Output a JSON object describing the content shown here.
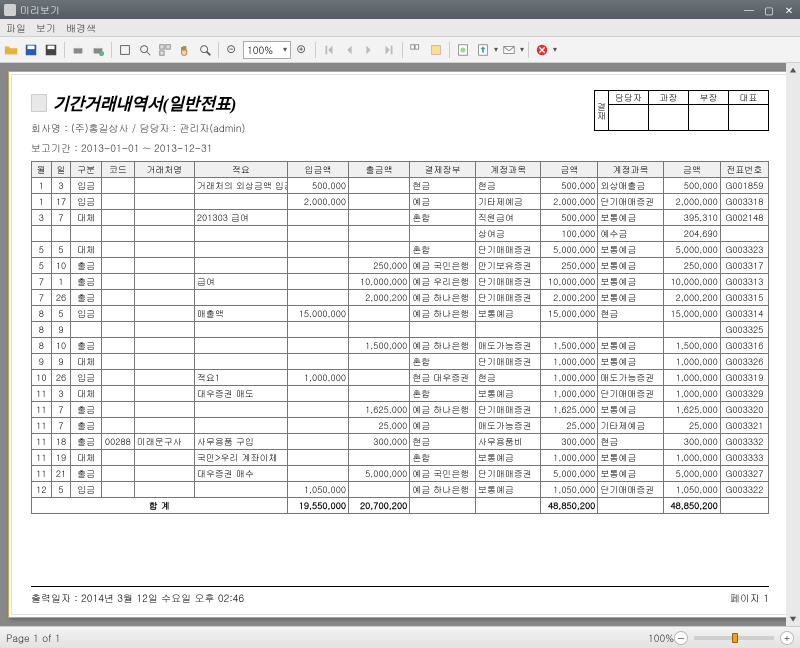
{
  "window": {
    "title": "미리보기"
  },
  "menu": {
    "file": "파일",
    "view": "보기",
    "bg": "배경색"
  },
  "toolbar": {
    "zoom": "100%"
  },
  "report": {
    "title": "기간거래내역서(일반전표)",
    "company_line": "회사명 :  (주)홍길상사 / 담당자 : 관리자(admin)",
    "period_line": "보고기간 :  2013-01-01  ~ 2013-12-31",
    "print_date": "출력일자 : 2014년 3월 12일 수요일 오후 02:46",
    "page_label": "페이지 1"
  },
  "approval": {
    "side": "결재",
    "c1": "담당자",
    "c2": "과장",
    "c3": "부장",
    "c4": "대표"
  },
  "columns": [
    "월",
    "일",
    "구분",
    "코드",
    "거래처명",
    "적요",
    "입금액",
    "출금액",
    "결제장부",
    "계정과목",
    "금액",
    "계정과목",
    "금액",
    "전표번호"
  ],
  "rows": [
    {
      "m": "1",
      "d": "3",
      "t": "입금",
      "code": "",
      "cust": "",
      "memo": "거래처의 외상금액 입금",
      "in": "500,000",
      "out": "",
      "book": "현금",
      "acc1": "현금",
      "amt1": "500,000",
      "acc2": "외상매출금",
      "amt2": "500,000",
      "no": "G001859"
    },
    {
      "m": "1",
      "d": "17",
      "t": "입금",
      "code": "",
      "cust": "",
      "memo": "",
      "in": "2,000,000",
      "out": "",
      "book": "예금",
      "acc1": "기타제예금",
      "amt1": "2,000,000",
      "acc2": "단기매매증권",
      "amt2": "2,000,000",
      "no": "G003318"
    },
    {
      "m": "3",
      "d": "7",
      "t": "대체",
      "code": "",
      "cust": "",
      "memo": "201303 급여",
      "in": "",
      "out": "",
      "book": "혼합",
      "acc1": "직원급여",
      "amt1": "500,000",
      "acc2": "보통예금",
      "amt2": "395,310",
      "no": "G002148"
    },
    {
      "m": "",
      "d": "",
      "t": "",
      "code": "",
      "cust": "",
      "memo": "",
      "in": "",
      "out": "",
      "book": "",
      "acc1": "상여금",
      "amt1": "100,000",
      "acc2": "예수금",
      "amt2": "204,690",
      "no": ""
    },
    {
      "m": "5",
      "d": "5",
      "t": "대체",
      "code": "",
      "cust": "",
      "memo": "",
      "in": "",
      "out": "",
      "book": "혼합",
      "acc1": "단기매매증권",
      "amt1": "5,000,000",
      "acc2": "보통예금",
      "amt2": "5,000,000",
      "no": "G003323"
    },
    {
      "m": "5",
      "d": "10",
      "t": "출금",
      "code": "",
      "cust": "",
      "memo": "",
      "in": "",
      "out": "250,000",
      "book": "예금 국민은행",
      "acc1": "만기보유증권",
      "amt1": "250,000",
      "acc2": "보통예금",
      "amt2": "250,000",
      "no": "G003317"
    },
    {
      "m": "7",
      "d": "1",
      "t": "출금",
      "code": "",
      "cust": "",
      "memo": "급여",
      "in": "",
      "out": "10,000,000",
      "book": "예금 우리은행",
      "acc1": "단기매매증권",
      "amt1": "10,000,000",
      "acc2": "보통예금",
      "amt2": "10,000,000",
      "no": "G003313"
    },
    {
      "m": "7",
      "d": "26",
      "t": "출금",
      "code": "",
      "cust": "",
      "memo": "",
      "in": "",
      "out": "2,000,200",
      "book": "예금 하나은행",
      "acc1": "단기매매증권",
      "amt1": "2,000,200",
      "acc2": "보통예금",
      "amt2": "2,000,200",
      "no": "G003315"
    },
    {
      "m": "8",
      "d": "5",
      "t": "입금",
      "code": "",
      "cust": "",
      "memo": "매출액",
      "in": "15,000,000",
      "out": "",
      "book": "예금 하나은행",
      "acc1": "보통예금",
      "amt1": "15,000,000",
      "acc2": "현금",
      "amt2": "15,000,000",
      "no": "G003314"
    },
    {
      "m": "8",
      "d": "9",
      "t": "",
      "code": "",
      "cust": "",
      "memo": "",
      "in": "",
      "out": "",
      "book": "",
      "acc1": "",
      "amt1": "",
      "acc2": "",
      "amt2": "",
      "no": "G003325"
    },
    {
      "m": "8",
      "d": "10",
      "t": "출금",
      "code": "",
      "cust": "",
      "memo": "",
      "in": "",
      "out": "1,500,000",
      "book": "예금 하나은행",
      "acc1": "매도가능증권",
      "amt1": "1,500,000",
      "acc2": "보통예금",
      "amt2": "1,500,000",
      "no": "G003316"
    },
    {
      "m": "9",
      "d": "9",
      "t": "대체",
      "code": "",
      "cust": "",
      "memo": "",
      "in": "",
      "out": "",
      "book": "혼합",
      "acc1": "단기매매증권",
      "amt1": "1,000,000",
      "acc2": "보통예금",
      "amt2": "1,000,000",
      "no": "G003326"
    },
    {
      "m": "10",
      "d": "26",
      "t": "입금",
      "code": "",
      "cust": "",
      "memo": "적요1",
      "in": "1,000,000",
      "out": "",
      "book": "현금 대우증권",
      "acc1": "현금",
      "amt1": "1,000,000",
      "acc2": "매도가능증권",
      "amt2": "1,000,000",
      "no": "G003319"
    },
    {
      "m": "11",
      "d": "3",
      "t": "대체",
      "code": "",
      "cust": "",
      "memo": "대우증권 매도",
      "in": "",
      "out": "",
      "book": "혼합",
      "acc1": "보통예금",
      "amt1": "1,000,000",
      "acc2": "단기매매증권",
      "amt2": "1,000,000",
      "no": "G003329"
    },
    {
      "m": "11",
      "d": "7",
      "t": "출금",
      "code": "",
      "cust": "",
      "memo": "",
      "in": "",
      "out": "1,625,000",
      "book": "예금 하나은행",
      "acc1": "단기매매증권",
      "amt1": "1,625,000",
      "acc2": "보통예금",
      "amt2": "1,625,000",
      "no": "G003320"
    },
    {
      "m": "11",
      "d": "7",
      "t": "출금",
      "code": "",
      "cust": "",
      "memo": "",
      "in": "",
      "out": "25,000",
      "book": "예금",
      "acc1": "매도가능증권",
      "amt1": "25,000",
      "acc2": "기타제예금",
      "amt2": "25,000",
      "no": "G003321"
    },
    {
      "m": "11",
      "d": "18",
      "t": "출금",
      "code": "00288",
      "cust": "미래문구사",
      "memo": "사무용품 구입",
      "in": "",
      "out": "300,000",
      "book": "현금",
      "acc1": "사무용품비",
      "amt1": "300,000",
      "acc2": "현금",
      "amt2": "300,000",
      "no": "G003332"
    },
    {
      "m": "11",
      "d": "19",
      "t": "대체",
      "code": "",
      "cust": "",
      "memo": "국민>우리 계좌이체",
      "in": "",
      "out": "",
      "book": "혼합",
      "acc1": "보통예금",
      "amt1": "1,000,000",
      "acc2": "보통예금",
      "amt2": "1,000,000",
      "no": "G003333"
    },
    {
      "m": "11",
      "d": "21",
      "t": "출금",
      "code": "",
      "cust": "",
      "memo": "대우증권 매수",
      "in": "",
      "out": "5,000,000",
      "book": "예금 국민은행",
      "acc1": "단기매매증권",
      "amt1": "5,000,000",
      "acc2": "보통예금",
      "amt2": "5,000,000",
      "no": "G003327"
    },
    {
      "m": "12",
      "d": "5",
      "t": "입금",
      "code": "",
      "cust": "",
      "memo": "",
      "in": "1,050,000",
      "out": "",
      "book": "예금 하나은행",
      "acc1": "보통예금",
      "amt1": "1,050,000",
      "acc2": "단기매매증권",
      "amt2": "1,050,000",
      "no": "G003322"
    }
  ],
  "total": {
    "label": "합 계",
    "in": "19,550,000",
    "out": "20,700,200",
    "amt1": "48,850,200",
    "amt2": "48,850,200"
  },
  "status": {
    "page": "Page 1 of 1",
    "zoom": "100%"
  }
}
